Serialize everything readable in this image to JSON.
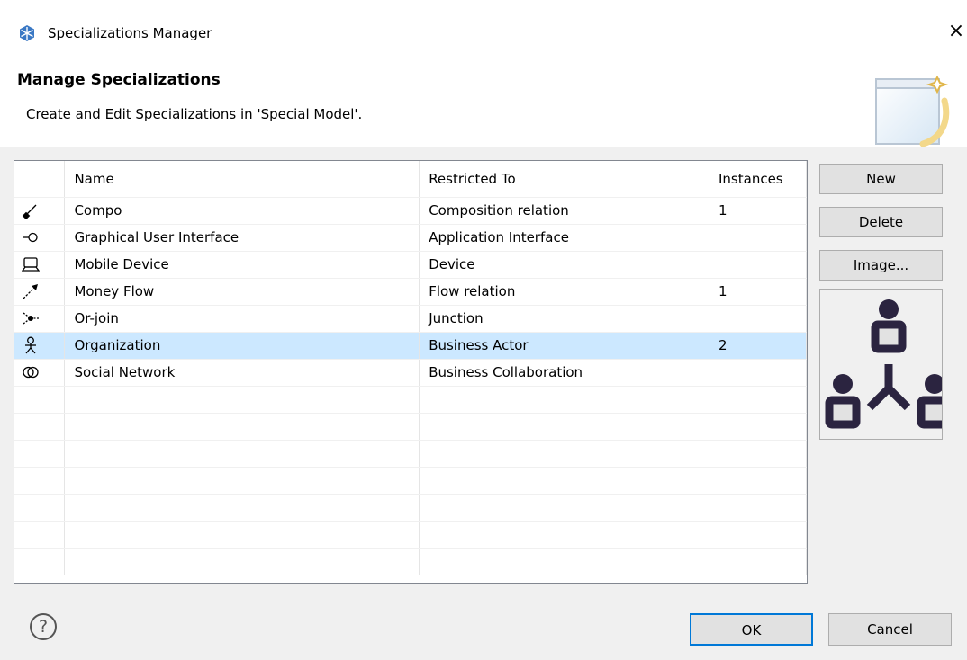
{
  "window": {
    "title": "Specializations Manager",
    "close_glyph": "×",
    "icon": "archi-app-icon"
  },
  "header": {
    "title": "Manage Specializations",
    "description": "Create and Edit Specializations in 'Special Model'."
  },
  "table": {
    "columns": [
      "",
      "Name",
      "Restricted To",
      "Instances"
    ],
    "rows": [
      {
        "icon": "composition-relation-icon",
        "name": "Compo",
        "restricted_to": "Composition relation",
        "instances": "1",
        "selected": false
      },
      {
        "icon": "application-interface-icon",
        "name": "Graphical User Interface",
        "restricted_to": "Application Interface",
        "instances": "",
        "selected": false
      },
      {
        "icon": "device-icon",
        "name": "Mobile Device",
        "restricted_to": "Device",
        "instances": "",
        "selected": false
      },
      {
        "icon": "flow-relation-icon",
        "name": "Money Flow",
        "restricted_to": "Flow relation",
        "instances": "1",
        "selected": false
      },
      {
        "icon": "junction-icon",
        "name": "Or-join",
        "restricted_to": "Junction",
        "instances": "",
        "selected": false
      },
      {
        "icon": "business-actor-icon",
        "name": "Organization",
        "restricted_to": "Business Actor",
        "instances": "2",
        "selected": true
      },
      {
        "icon": "business-collaboration-icon",
        "name": "Social Network",
        "restricted_to": "Business Collaboration",
        "instances": "",
        "selected": false
      }
    ]
  },
  "side_buttons": {
    "new": "New",
    "delete": "Delete",
    "image": "Image..."
  },
  "preview": {
    "icon": "organization-hierarchy-icon"
  },
  "footer": {
    "help_glyph": "?",
    "ok": "OK",
    "cancel": "Cancel"
  },
  "colors": {
    "selection": "#cce8ff",
    "default_button_border": "#0078d7",
    "preview_icon": "#2b2440"
  }
}
